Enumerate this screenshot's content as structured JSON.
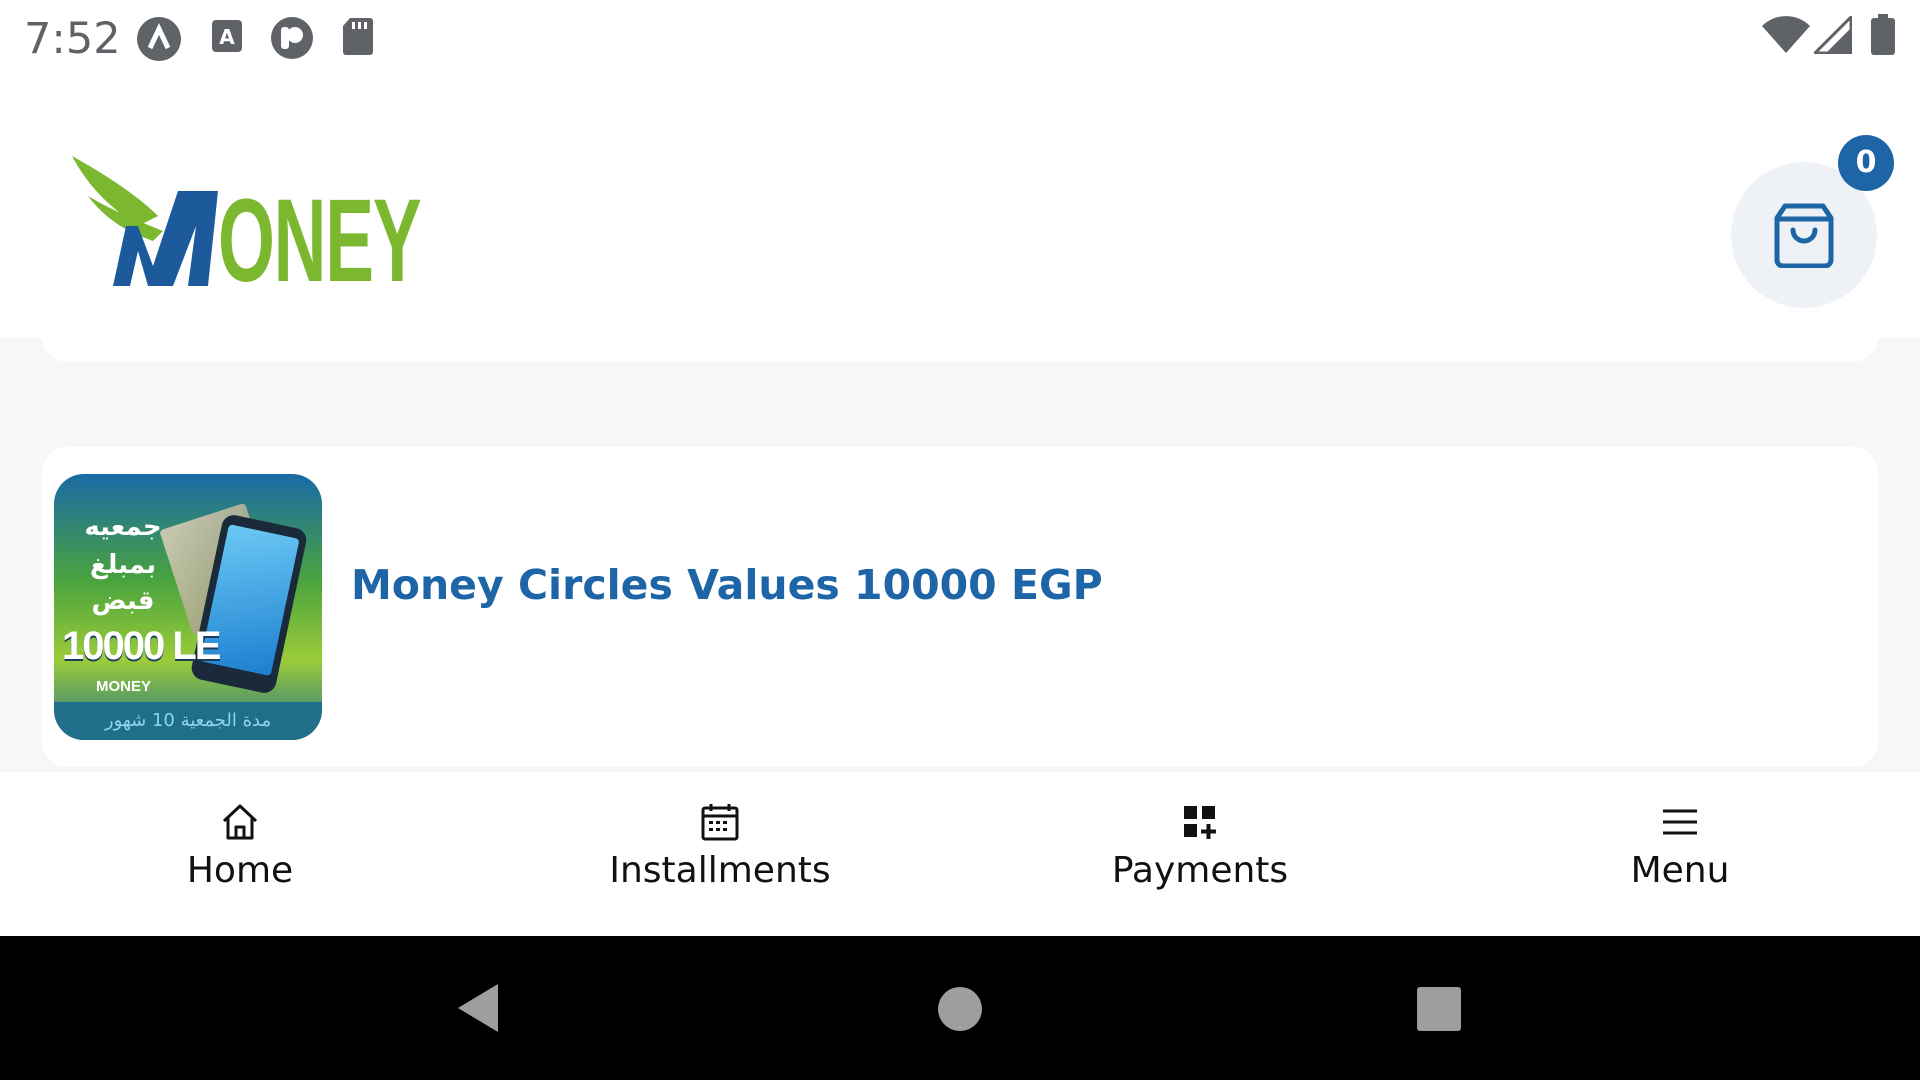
{
  "status_bar": {
    "time": "7:52",
    "left_icons": [
      "app-icon-a",
      "font-icon",
      "app-icon-p",
      "sd-card-icon"
    ],
    "right_icons": [
      "wifi-icon",
      "signal-icon",
      "battery-icon"
    ]
  },
  "header": {
    "logo_text": "ONEY",
    "logo_colors": {
      "wing": "#7cb82f",
      "m": "#1d5a9b",
      "text": "#7cb82f"
    },
    "cart": {
      "icon": "shopping-bag-icon",
      "badge_count": "0"
    }
  },
  "product": {
    "title": "Money Circles Values 10000 EGP",
    "thumbnail": {
      "arabic_lines": [
        "جمعيه",
        "بمبلغ",
        "قبض"
      ],
      "amount": "10000 LE",
      "logo_text": "MONEY",
      "footer": "مدة الجمعية 10 شهور"
    }
  },
  "bottom_nav": {
    "items": [
      {
        "label": "Home",
        "icon": "home-icon"
      },
      {
        "label": "Installments",
        "icon": "calendar-icon"
      },
      {
        "label": "Payments",
        "icon": "grid-add-icon"
      },
      {
        "label": "Menu",
        "icon": "menu-icon"
      }
    ]
  },
  "system_nav": {
    "icons": [
      "back-icon",
      "home-circle-icon",
      "recents-icon"
    ]
  },
  "colors": {
    "accent": "#1d65a6",
    "brand_green": "#7cb82f",
    "background": "#f7f7f7"
  }
}
